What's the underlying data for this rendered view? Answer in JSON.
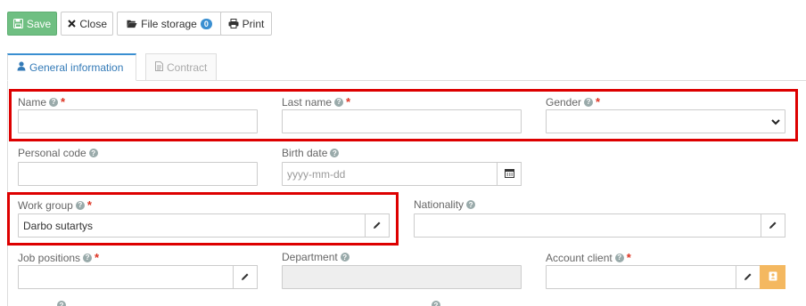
{
  "toolbar": {
    "save_label": "Save",
    "close_label": "Close",
    "file_storage_label": "File storage",
    "file_storage_count": "0",
    "print_label": "Print"
  },
  "tabs": [
    {
      "label": "General information",
      "active": true
    },
    {
      "label": "Contract",
      "active": false
    }
  ],
  "form": {
    "name": {
      "label": "Name",
      "required": "*",
      "value": ""
    },
    "last_name": {
      "label": "Last name",
      "required": "*",
      "value": ""
    },
    "gender": {
      "label": "Gender",
      "required": "*",
      "value": ""
    },
    "personal_code": {
      "label": "Personal code",
      "value": ""
    },
    "birth_date": {
      "label": "Birth date",
      "placeholder": "yyyy-mm-dd"
    },
    "work_group": {
      "label": "Work group",
      "required": "*",
      "value": "Darbo sutartys"
    },
    "nationality": {
      "label": "Nationality",
      "value": ""
    },
    "job_positions": {
      "label": "Job positions",
      "required": "*",
      "value": ""
    },
    "department": {
      "label": "Department",
      "value": ""
    },
    "account_client": {
      "label": "Account client",
      "required": "*",
      "value": ""
    }
  },
  "icons": {
    "save": "floppy-disk-icon",
    "close": "x-icon",
    "folder": "folder-open-icon",
    "print": "printer-icon",
    "user": "user-icon",
    "document": "document-icon",
    "help": "question-circle-icon",
    "pencil": "pencil-icon",
    "calendar": "calendar-icon",
    "chevron": "chevron-down-icon",
    "contact": "contact-card-icon"
  },
  "colors": {
    "save_button": "#6fbf82",
    "active_tab_accent": "#3a8fd1",
    "required": "#dd3322",
    "highlight": "#dd0000",
    "contact_button": "#f4b860"
  }
}
